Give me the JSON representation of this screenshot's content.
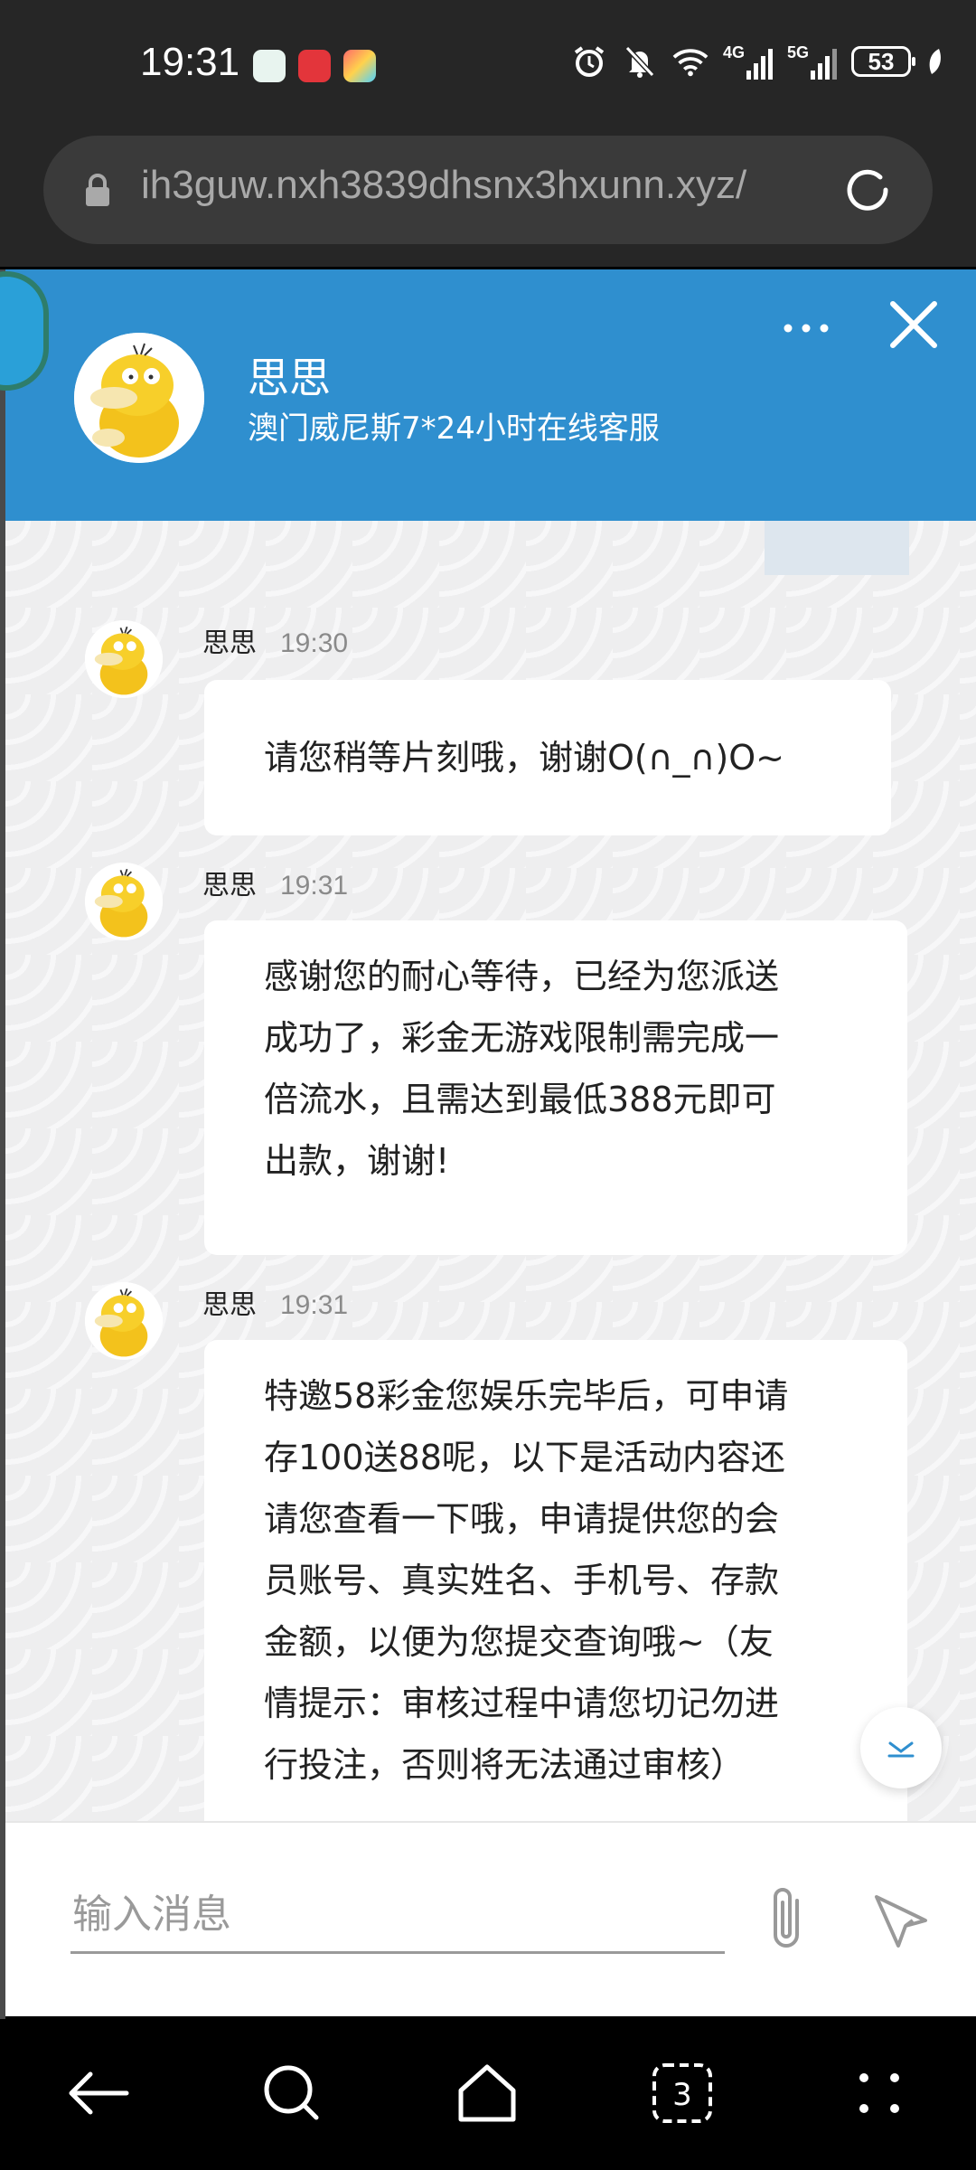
{
  "status_bar": {
    "time": "19:31",
    "network_4g": "4G",
    "network_5g": "5G",
    "battery": "53"
  },
  "browser": {
    "url": "ih3guw.nxh3839dhsnx3hxunn.xyz/"
  },
  "chat_header": {
    "agent_name": "思思",
    "agent_subtitle": "澳门威尼斯7*24小时在线客服"
  },
  "messages": [
    {
      "sender": "思思",
      "time": "19:30",
      "text": "请您稍等片刻哦，谢谢O(∩_∩)O~"
    },
    {
      "sender": "思思",
      "time": "19:31",
      "lines": [
        "感谢您的耐心等待，已经为您派送",
        "成功了，彩金无游戏限制需完成一",
        "倍流水，且需达到最低388元即可",
        "出款，谢谢!"
      ]
    },
    {
      "sender": "思思",
      "time": "19:31",
      "lines": [
        "特邀58彩金您娱乐完毕后，可申请",
        "存100送88呢，以下是活动内容还",
        "请您查看一下哦，申请提供您的会",
        "员账号、真实姓名、手机号、存款",
        "金额，以便为您提交查询哦~（友",
        "情提示：审核过程中请您切记勿进",
        "行投注，否则将无法通过审核）"
      ]
    }
  ],
  "input": {
    "placeholder": "输入消息"
  },
  "nav": {
    "tabs_count": "3"
  },
  "colors": {
    "header": "#2f8fcf",
    "chat_bg": "#eeeeef",
    "bubble": "#ffffff"
  }
}
